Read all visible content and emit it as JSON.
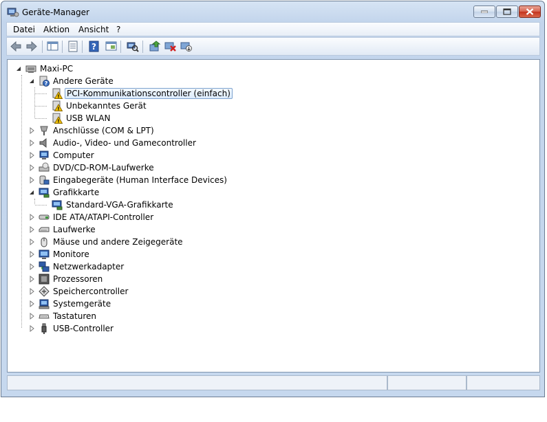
{
  "window": {
    "title": "Geräte-Manager"
  },
  "menu": [
    {
      "label": "Datei"
    },
    {
      "label": "Aktion"
    },
    {
      "label": "Ansicht"
    },
    {
      "label": "?"
    }
  ],
  "toolbar_icons": [
    "back-icon",
    "forward-icon",
    "console-tree-icon",
    "properties-icon",
    "help-icon",
    "view-icon",
    "scan-hardware-icon",
    "update-driver-icon",
    "uninstall-icon",
    "disable-icon"
  ],
  "tree": {
    "root": "Maxi-PC",
    "andere": {
      "label": "Andere Geräte",
      "children": [
        "PCI-Kommunikationscontroller (einfach)",
        "Unbekanntes Gerät",
        "USB WLAN"
      ]
    },
    "categories1": [
      "Anschlüsse (COM & LPT)",
      "Audio-, Video- und Gamecontroller",
      "Computer",
      "DVD/CD-ROM-Laufwerke",
      "Eingabegeräte (Human Interface Devices)"
    ],
    "grafik": {
      "label": "Grafikkarte",
      "child": "Standard-VGA-Grafikkarte"
    },
    "categories2": [
      "IDE ATA/ATAPI-Controller",
      "Laufwerke",
      "Mäuse und andere Zeigegeräte",
      "Monitore",
      "Netzwerkadapter",
      "Prozessoren",
      "Speichercontroller",
      "Systemgeräte",
      "Tastaturen",
      "USB-Controller"
    ],
    "selected": "PCI-Kommunikationscontroller (einfach)"
  },
  "colors": {
    "selection": "#dcebfc",
    "warning": "#f2c200",
    "titlebar": "#c6d8ee"
  }
}
